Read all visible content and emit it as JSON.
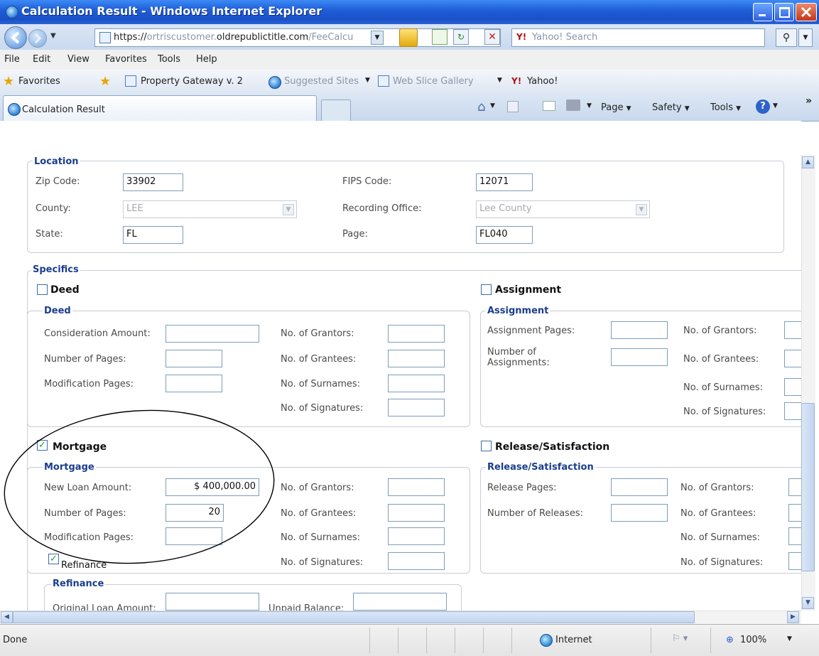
{
  "window": {
    "title": "Calculation Result - Windows Internet Explorer"
  },
  "address": {
    "prefix": "https://",
    "host_pre": "ortriscustomer.",
    "host_main": "oldrepublictitle.com",
    "path": "/FeeCalcu"
  },
  "search": {
    "placeholder": "Yahoo! Search"
  },
  "menu": [
    "File",
    "Edit",
    "View",
    "Favorites",
    "Tools",
    "Help"
  ],
  "favorites": {
    "label": "Favorites",
    "items": [
      "Property Gateway v. 2",
      "Suggested Sites",
      "Web Slice Gallery",
      "Yahoo!"
    ]
  },
  "tab": {
    "title": "Calculation Result"
  },
  "commands": {
    "page": "Page",
    "safety": "Safety",
    "tools": "Tools"
  },
  "location": {
    "legend": "Location",
    "zip_label": "Zip Code:",
    "zip": "33902",
    "county_label": "County:",
    "county": "LEE",
    "state_label": "State:",
    "state": "FL",
    "fips_label": "FIPS Code:",
    "fips": "12071",
    "office_label": "Recording Office:",
    "office": "Lee County",
    "page_label": "Page:",
    "page": "FL040"
  },
  "specifics": {
    "legend": "Specifics"
  },
  "deed": {
    "check_label": "Deed",
    "checked": false,
    "legend": "Deed",
    "consideration": "Consideration Amount:",
    "pages": "Number of Pages:",
    "mod_pages": "Modification Pages:",
    "grantors": "No. of Grantors:",
    "grantees": "No. of Grantees:",
    "surnames": "No. of Surnames:",
    "signatures": "No. of Signatures:"
  },
  "assignment": {
    "check_label": "Assignment",
    "checked": false,
    "legend": "Assignment",
    "pages": "Assignment Pages:",
    "number": "Number of Assignments:",
    "grantors": "No. of Grantors:",
    "grantees": "No. of Grantees:",
    "surnames": "No. of Surnames:",
    "signatures": "No. of Signatures:"
  },
  "mortgage": {
    "check_label": "Mortgage",
    "checked": true,
    "legend": "Mortgage",
    "loan_label": "New Loan Amount:",
    "loan": "$ 400,000.00",
    "pages_label": "Number of Pages:",
    "pages": "20",
    "mod_label": "Modification Pages:",
    "grantors": "No. of Grantors:",
    "grantees": "No. of Grantees:",
    "surnames": "No. of Surnames:",
    "signatures": "No. of Signatures:",
    "refinance_label": "Refinance",
    "refinance_checked": true
  },
  "release": {
    "check_label": "Release/Satisfaction",
    "checked": false,
    "legend": "Release/Satisfaction",
    "pages": "Release Pages:",
    "number": "Number of Releases:",
    "grantors": "No. of Grantors:",
    "grantees": "No. of Grantees:",
    "surnames": "No. of Surnames:",
    "signatures": "No. of Signatures:"
  },
  "refinance": {
    "legend": "Refinance",
    "orig_label": "Original Loan Amount:",
    "unpaid_label": "Unpaid Balance:"
  },
  "status": {
    "text": "Done",
    "zone": "Internet",
    "zoom": "100%"
  },
  "check_mark": "✓"
}
